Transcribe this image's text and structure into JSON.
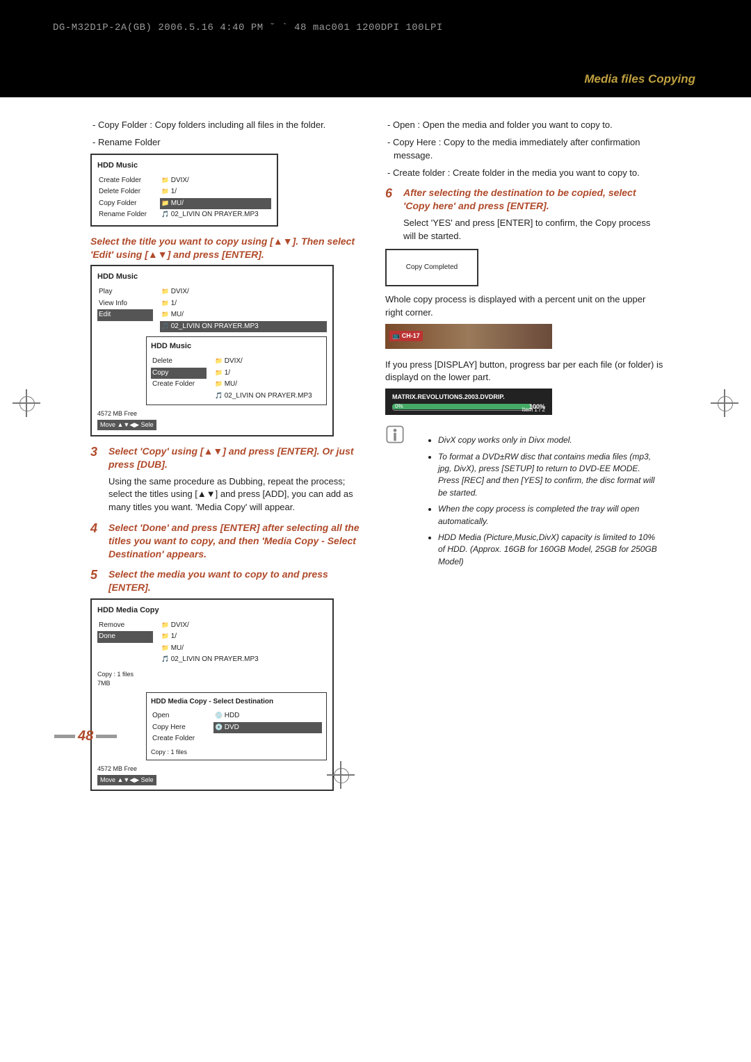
{
  "headerLine": "DG-M32D1P-2A(GB)  2006.5.16 4:40 PM  ˘ ` 48   mac001  1200DPI 100LPI",
  "sectionTitle": "Media files Copying",
  "left": {
    "dash1": "Copy Folder : Copy folders including all files in the folder.",
    "dash2": "Rename Folder",
    "panel1": {
      "title": "HDD Music",
      "menu": [
        "Create Folder",
        "Delete Folder",
        "Copy Folder",
        "Rename Folder"
      ],
      "files": [
        "DVIX/",
        "1/",
        "MU/",
        "02_LIVIN ON PRAYER.MP3"
      ],
      "sel": "MU/"
    },
    "step2": "Select the title you want to copy using [▲▼]. Then select 'Edit' using [▲▼] and press [ENTER].",
    "panel2": {
      "title": "HDD Music",
      "menu": [
        "Play",
        "View Info",
        "Edit"
      ],
      "menuSel": "Edit",
      "files": [
        "DVIX/",
        "1/",
        "MU/",
        "02_LIVIN ON PRAYER.MP3"
      ],
      "sub": {
        "title": "HDD Music",
        "menu": [
          "Delete",
          "Copy",
          "Create Folder"
        ],
        "menuSel": "Copy",
        "files": [
          "DVIX/",
          "1/",
          "MU/",
          "02_LIVIN ON PRAYER.MP3"
        ]
      },
      "free": "4572 MB Free",
      "move": "Move ▲▼◀▶  Sele"
    },
    "step3num": "3",
    "step3": "Select 'Copy' using [▲▼] and press [ENTER]. Or just press [DUB].",
    "step3body": "Using the same procedure as Dubbing, repeat the process; select the titles using [▲▼] and press [ADD], you can add as many titles you want. 'Media Copy' will appear.",
    "step4num": "4",
    "step4": "Select 'Done' and press [ENTER] after selecting all the titles you want to copy, and then 'Media Copy - Select Destination' appears.",
    "step5num": "5",
    "step5": "Select the media you want to copy to and press [ENTER].",
    "panel3": {
      "title": "HDD Media Copy",
      "menu": [
        "Remove",
        "Done"
      ],
      "menuSel": "Done",
      "files": [
        "DVIX/",
        "1/",
        "MU/",
        "02_LIVIN ON PRAYER.MP3"
      ],
      "copy": "Copy : 1 files",
      "size": "7MB",
      "free": "4572 MB Free",
      "move": "Move ▲▼◀▶  Sele",
      "sub": {
        "title": "HDD Media Copy - Select Destination",
        "menu": [
          "Open",
          "Copy Here",
          "Create Folder"
        ],
        "dest": [
          "HDD",
          "DVD"
        ],
        "destSel": "DVD",
        "copy": "Copy : 1 files"
      }
    }
  },
  "right": {
    "dash1": "Open : Open the media and folder you want to copy to.",
    "dash2": "Copy Here : Copy to the media immediately after confirmation message.",
    "dash3": "Create folder : Create folder in the media you want to copy to.",
    "step6num": "6",
    "step6": "After selecting the destination to be copied, select 'Copy here' and press [ENTER].",
    "step6body": "Select 'YES' and press [ENTER] to confirm, the Copy process will be started.",
    "copyDone": "Copy Completed",
    "para1": "Whole copy process is displayed with a percent unit on the upper right corner.",
    "ch": "📺 CH-17",
    "para2": "If you press [DISPLAY] button, progress bar per each file (or folder) is displayd on the lower part.",
    "progTitle": "MATRIX.REVOLUTIONS.2003.DVDRIP.",
    "progPct": "100%",
    "progLeft": "0%",
    "progItem": "Item 1 / 2",
    "notes": [
      "DivX copy works only in Divx model.",
      "To format a DVD±RW disc that contains media files (mp3, jpg, DivX), press [SETUP] to return to DVD-EE MODE. Press [REC] and then [YES] to confirm, the disc format will be started.",
      "When the copy process is completed the tray will open automatically.",
      "HDD Media (Picture,Music,DivX) capacity is limited to 10% of HDD. (Approx. 16GB for 160GB Model, 25GB for 250GB Model)"
    ]
  },
  "pageNum": "48"
}
